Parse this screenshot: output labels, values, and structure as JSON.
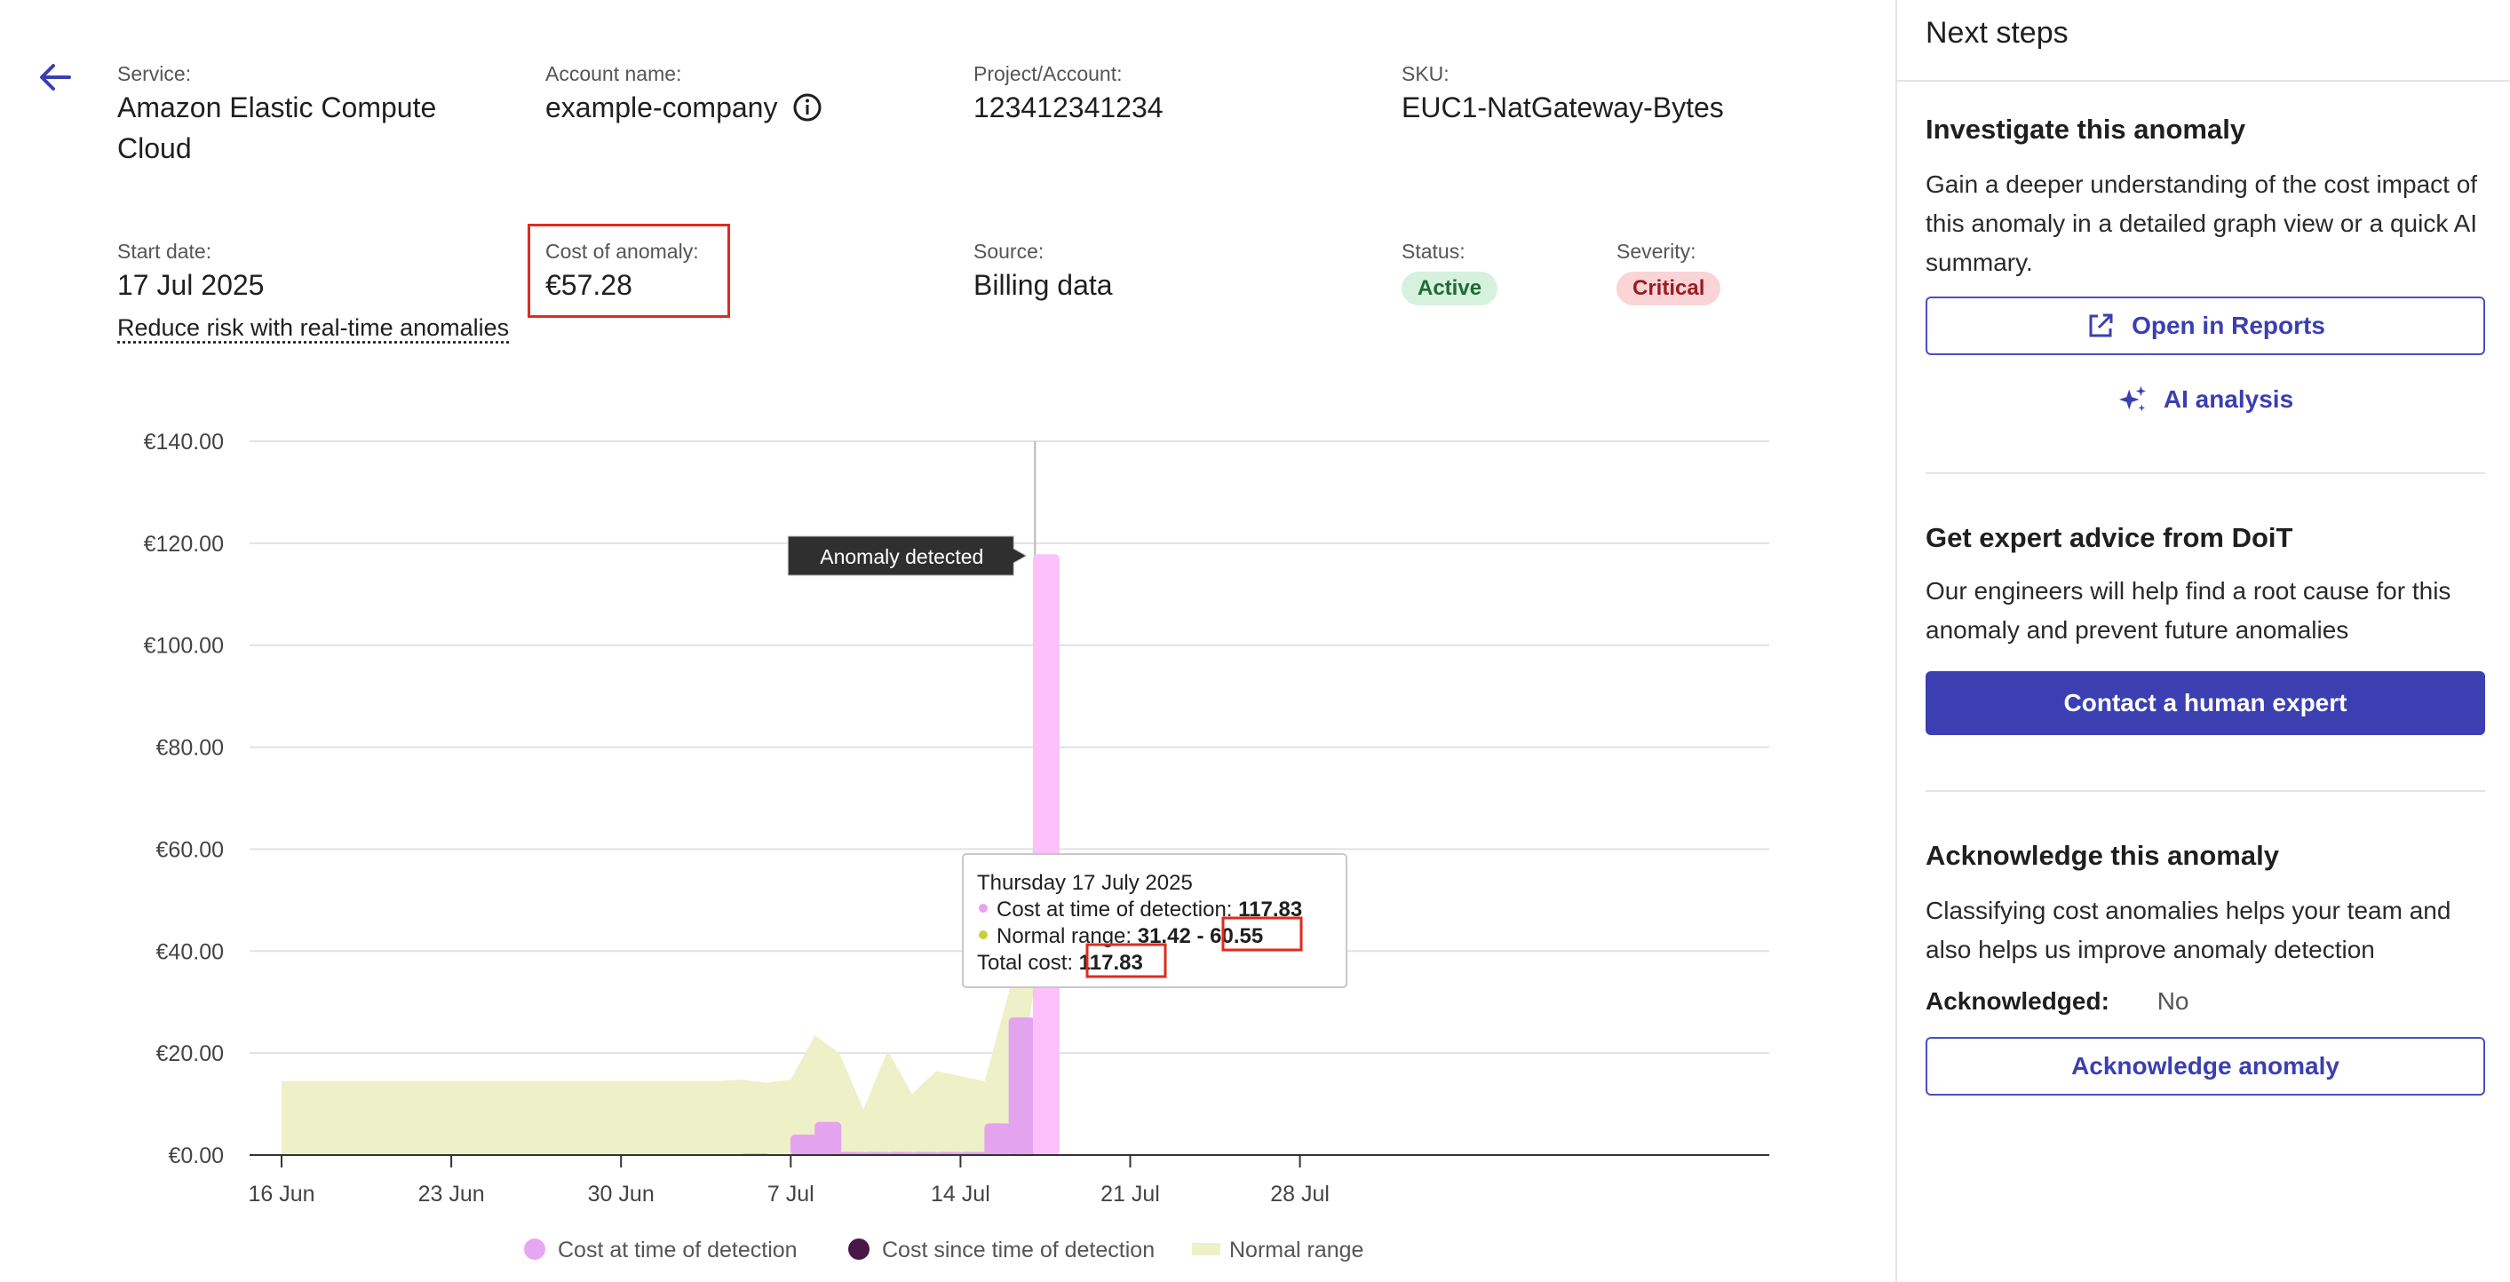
{
  "header": {
    "service": {
      "label": "Service:",
      "value_line1": "Amazon Elastic Compute",
      "value_line2": "Cloud"
    },
    "account": {
      "label": "Account name:",
      "value": "example-company"
    },
    "project": {
      "label": "Project/Account:",
      "value": "123412341234"
    },
    "sku": {
      "label": "SKU:",
      "value": "EUC1-NatGateway-Bytes"
    },
    "start_date": {
      "label": "Start date:",
      "value": "17 Jul 2025"
    },
    "cost": {
      "label": "Cost of anomaly:",
      "value": "€57.28"
    },
    "source": {
      "label": "Source:",
      "value": "Billing data"
    },
    "status": {
      "label": "Status:",
      "value": "Active"
    },
    "severity": {
      "label": "Severity:",
      "value": "Critical"
    },
    "reduce_link": "Reduce risk with real-time anomalies"
  },
  "chart_data": {
    "type": "bar",
    "y_ticks": [
      "€140.00",
      "€120.00",
      "€100.00",
      "€80.00",
      "€60.00",
      "€40.00",
      "€20.00",
      "€0.00"
    ],
    "ylim": [
      0,
      140
    ],
    "x_ticks": [
      "16 Jun",
      "23 Jun",
      "30 Jun",
      "7 Jul",
      "14 Jul",
      "21 Jul",
      "28 Jul"
    ],
    "x_start": "2025-06-16",
    "x_end": "2025-07-28",
    "cost_at_detection": [
      {
        "date": "2025-07-05",
        "value": 0.3
      },
      {
        "date": "2025-07-07",
        "value": 4.0
      },
      {
        "date": "2025-07-08",
        "value": 6.5
      },
      {
        "date": "2025-07-09",
        "value": 0.6
      },
      {
        "date": "2025-07-10",
        "value": 0.6
      },
      {
        "date": "2025-07-11",
        "value": 0.6
      },
      {
        "date": "2025-07-12",
        "value": 0.6
      },
      {
        "date": "2025-07-13",
        "value": 0.6
      },
      {
        "date": "2025-07-14",
        "value": 0.6
      },
      {
        "date": "2025-07-15",
        "value": 6.2
      },
      {
        "date": "2025-07-16",
        "value": 27.0
      },
      {
        "date": "2025-07-17",
        "value": 117.83
      }
    ],
    "normal_range": [
      {
        "date": "2025-06-16",
        "low": 0,
        "high": 14.5
      },
      {
        "date": "2025-07-04",
        "low": 0,
        "high": 14.5
      },
      {
        "date": "2025-07-05",
        "low": 0,
        "high": 14.8
      },
      {
        "date": "2025-07-06",
        "low": 0,
        "high": 14.2
      },
      {
        "date": "2025-07-07",
        "low": 0,
        "high": 14.8
      },
      {
        "date": "2025-07-08",
        "low": 0,
        "high": 23.5
      },
      {
        "date": "2025-07-09",
        "low": 0,
        "high": 20.0
      },
      {
        "date": "2025-07-10",
        "low": 0,
        "high": 9.0
      },
      {
        "date": "2025-07-11",
        "low": 0,
        "high": 20.5
      },
      {
        "date": "2025-07-12",
        "low": 0,
        "high": 12.0
      },
      {
        "date": "2025-07-13",
        "low": 0,
        "high": 16.5
      },
      {
        "date": "2025-07-14",
        "low": 0,
        "high": 15.5
      },
      {
        "date": "2025-07-15",
        "low": 0,
        "high": 14.5
      },
      {
        "date": "2025-07-16",
        "low": 0,
        "high": 32.0
      },
      {
        "date": "2025-07-17",
        "low": 31.42,
        "high": 60.55
      }
    ],
    "anomaly_date": "2025-07-17",
    "anomaly_label": "Anomaly detected",
    "legend": [
      {
        "name": "Cost at time of detection",
        "color": "#e7a6f2"
      },
      {
        "name": "Cost since time of detection",
        "color": "#4a1848"
      },
      {
        "name": "Normal range",
        "color": "#eef0c8"
      }
    ],
    "tooltip": {
      "title": "Thursday 17 July 2025",
      "cost_label": "Cost at time of detection:",
      "cost_value": "117.83",
      "range_label": "Normal range:",
      "range_low": "31.42",
      "range_sep": "-",
      "range_high": "60.55",
      "total_label": "Total cost:",
      "total_value": "117.83"
    },
    "colors": {
      "bar": "#e4a3ef",
      "bar_highlight": "#fcc0fb",
      "range": "#eef0c8",
      "grid": "#e2e2e2",
      "axis": "#333333"
    }
  },
  "side": {
    "title": "Next steps",
    "investigate": {
      "title": "Investigate this anomaly",
      "desc": "Gain a deeper understanding of the cost impact of this anomaly in a detailed graph view or a quick AI summary.",
      "reports_btn": "Open in Reports",
      "ai_btn": "AI analysis"
    },
    "expert": {
      "title": "Get expert advice from DoiT",
      "desc": "Our engineers will help find a root cause for this anomaly and prevent future anomalies",
      "contact_btn": "Contact a human expert"
    },
    "acknowledge": {
      "title": "Acknowledge this anomaly",
      "desc": "Classifying cost anomalies helps your team and also helps us improve anomaly detection",
      "ack_label": "Acknowledged:",
      "ack_value": "No",
      "ack_btn": "Acknowledge anomaly"
    }
  },
  "accent": "#3b3fb1"
}
